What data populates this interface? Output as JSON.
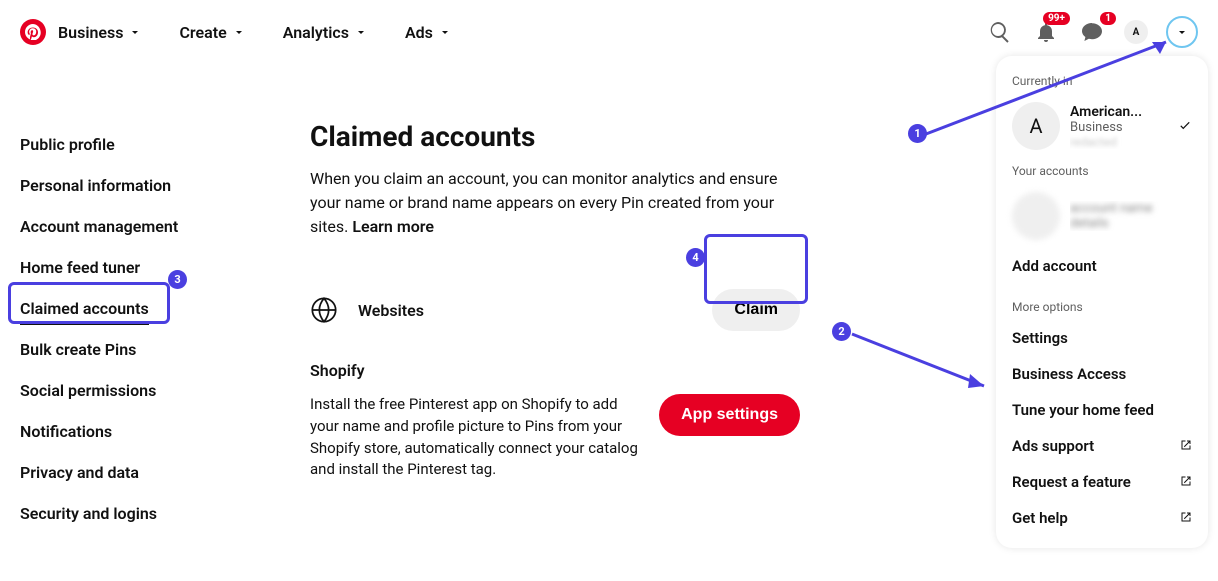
{
  "header": {
    "nav": [
      "Business",
      "Create",
      "Analytics",
      "Ads"
    ],
    "notif_badge": "99+",
    "msg_badge": "1",
    "avatar_letter": "A"
  },
  "sidebar": {
    "items": [
      "Public profile",
      "Personal information",
      "Account management",
      "Home feed tuner",
      "Claimed accounts",
      "Bulk create Pins",
      "Social permissions",
      "Notifications",
      "Privacy and data",
      "Security and logins"
    ],
    "active_index": 4
  },
  "content": {
    "title": "Claimed accounts",
    "desc": "When you claim an account, you can monitor analytics and ensure your name or brand name appears on every Pin created from your sites. ",
    "learn_more": "Learn more",
    "websites_label": "Websites",
    "claim_btn": "Claim",
    "shopify_title": "Shopify",
    "shopify_desc": "Install the free Pinterest app on Shopify to add your name and profile picture to Pins from your Shopify store, automatically connect your catalog and install the Pinterest tag.",
    "app_settings_btn": "App settings"
  },
  "panel": {
    "currently_in": "Currently in",
    "account_name": "American...",
    "account_type": "Business",
    "account_avatar": "A",
    "your_accounts": "Your accounts",
    "add_account": "Add account",
    "more_options": "More options",
    "options": [
      {
        "label": "Settings",
        "ext": false
      },
      {
        "label": "Business Access",
        "ext": false
      },
      {
        "label": "Tune your home feed",
        "ext": false
      },
      {
        "label": "Ads support",
        "ext": true
      },
      {
        "label": "Request a feature",
        "ext": true
      },
      {
        "label": "Get help",
        "ext": true
      }
    ]
  },
  "annotations": {
    "n1": "1",
    "n2": "2",
    "n3": "3",
    "n4": "4"
  }
}
